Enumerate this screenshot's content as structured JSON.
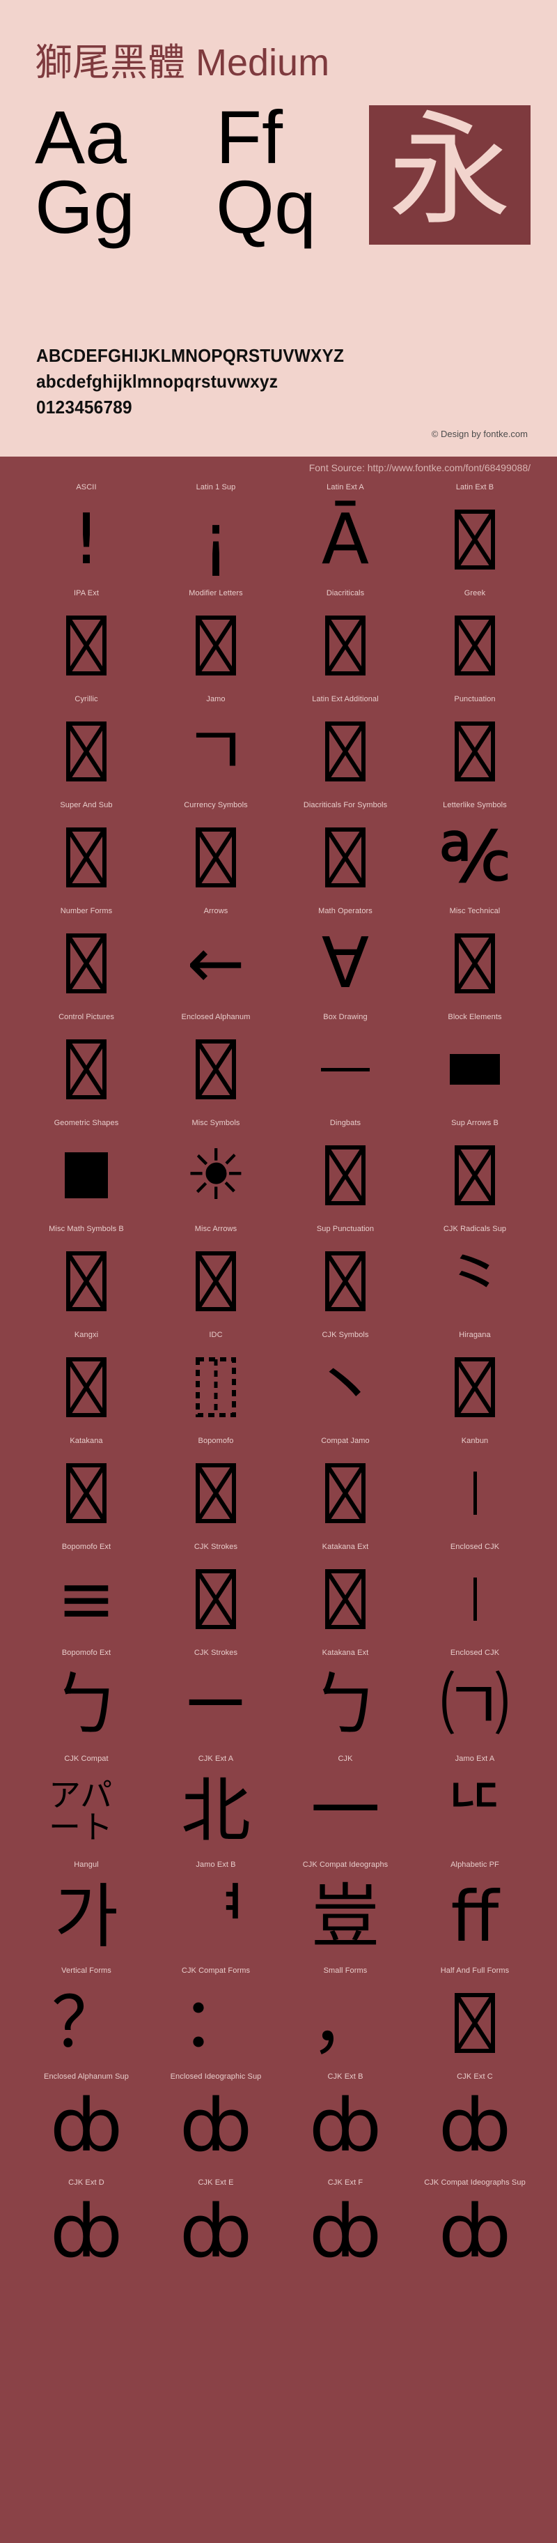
{
  "header": {
    "title_cjk": "獅尾黑體",
    "title_style": "Medium",
    "samples": {
      "aa": "Aa",
      "ff": "Ff",
      "gg": "Gg",
      "qq": "Qq",
      "yong": "永"
    },
    "alphabet_upper": "ABCDEFGHIJKLMNOPQRSTUVWXYZ",
    "alphabet_lower": "abcdefghijklmnopqrstuvwxyz",
    "digits": "0123456789",
    "copyright": "© Design by fontke.com"
  },
  "source": {
    "label": "Font Source: http://www.fontke.com/font/68499088/"
  },
  "colors": {
    "header_bg": "#f2d4cd",
    "body_bg": "#8a4247",
    "title_fg": "#7e3a3e",
    "label_fg": "#e8cdcb",
    "glyph_fg": "#000000",
    "source_fg": "#d8b4b2"
  },
  "grid": {
    "rows": [
      [
        {
          "label": "ASCII",
          "glyph": "!",
          "kind": "big"
        },
        {
          "label": "Latin 1 Sup",
          "glyph": "¡",
          "kind": "big"
        },
        {
          "label": "Latin Ext A",
          "glyph": "Ā",
          "kind": "big"
        },
        {
          "label": "Latin Ext B",
          "glyph": "notdef",
          "kind": "notdef"
        }
      ],
      [
        {
          "label": "IPA Ext",
          "glyph": "notdef",
          "kind": "notdef"
        },
        {
          "label": "Modifier Letters",
          "glyph": "notdef",
          "kind": "notdef"
        },
        {
          "label": "Diacriticals",
          "glyph": "notdef",
          "kind": "notdef"
        },
        {
          "label": "Greek",
          "glyph": "notdef",
          "kind": "notdef"
        }
      ],
      [
        {
          "label": "Cyrillic",
          "glyph": "notdef",
          "kind": "notdef"
        },
        {
          "label": "Jamo",
          "glyph": "ㄱ",
          "kind": "big"
        },
        {
          "label": "Latin Ext Additional",
          "glyph": "notdef",
          "kind": "notdef"
        },
        {
          "label": "Punctuation",
          "glyph": "notdef",
          "kind": "notdef"
        }
      ],
      [
        {
          "label": "Super And Sub",
          "glyph": "notdef",
          "kind": "notdef"
        },
        {
          "label": "Currency Symbols",
          "glyph": "notdef",
          "kind": "notdef"
        },
        {
          "label": "Diacriticals For Symbols",
          "glyph": "notdef",
          "kind": "notdef"
        },
        {
          "label": "Letterlike Symbols",
          "glyph": "℀",
          "kind": "big"
        }
      ],
      [
        {
          "label": "Number Forms",
          "glyph": "notdef",
          "kind": "notdef"
        },
        {
          "label": "Arrows",
          "glyph": "←",
          "kind": "big"
        },
        {
          "label": "Math Operators",
          "glyph": "∀",
          "kind": "big"
        },
        {
          "label": "Misc Technical",
          "glyph": "notdef",
          "kind": "notdef"
        }
      ],
      [
        {
          "label": "Control Pictures",
          "glyph": "notdef",
          "kind": "notdef"
        },
        {
          "label": "Enclosed Alphanum",
          "glyph": "notdef",
          "kind": "notdef"
        },
        {
          "label": "Box Drawing",
          "glyph": "─",
          "kind": "hline"
        },
        {
          "label": "Block Elements",
          "glyph": "█",
          "kind": "block"
        }
      ],
      [
        {
          "label": "Geometric Shapes",
          "glyph": "■",
          "kind": "square"
        },
        {
          "label": "Misc Symbols",
          "glyph": "☀",
          "kind": "big"
        },
        {
          "label": "Dingbats",
          "glyph": "notdef",
          "kind": "notdef"
        },
        {
          "label": "Sup Arrows B",
          "glyph": "notdef",
          "kind": "notdef"
        }
      ],
      [
        {
          "label": "Misc Math Symbols B",
          "glyph": "notdef",
          "kind": "notdef"
        },
        {
          "label": "Misc Arrows",
          "glyph": "notdef",
          "kind": "notdef"
        },
        {
          "label": "Sup Punctuation",
          "glyph": "notdef",
          "kind": "notdef"
        },
        {
          "label": "CJK Radicals Sup",
          "glyph": "⺀",
          "kind": "big"
        }
      ],
      [
        {
          "label": "Kangxi",
          "glyph": "notdef",
          "kind": "notdef"
        },
        {
          "label": "IDC",
          "glyph": "⿰",
          "kind": "idc"
        },
        {
          "label": "CJK Symbols",
          "glyph": "丶",
          "kind": "big"
        },
        {
          "label": "Hiragana",
          "glyph": "notdef",
          "kind": "notdef"
        }
      ],
      [
        {
          "label": "Katakana",
          "glyph": "notdef",
          "kind": "notdef"
        },
        {
          "label": "Bopomofo",
          "glyph": "notdef",
          "kind": "notdef"
        },
        {
          "label": "Compat Jamo",
          "glyph": "notdef",
          "kind": "notdef"
        },
        {
          "label": "Kanbun",
          "glyph": "丨",
          "kind": "vline"
        }
      ],
      [
        {
          "label": "Bopomofo Ext",
          "glyph": "≡",
          "kind": "big"
        },
        {
          "label": "CJK Strokes",
          "glyph": "notdef",
          "kind": "notdef"
        },
        {
          "label": "Katakana Ext",
          "glyph": "notdef",
          "kind": "notdef"
        },
        {
          "label": "Enclosed CJK",
          "glyph": "丨",
          "kind": "vline"
        }
      ],
      [
        {
          "label": "Bopomofo Ext",
          "glyph": "ㄅ",
          "kind": "big"
        },
        {
          "label": "CJK Strokes",
          "glyph": "ㄧ",
          "kind": "big"
        },
        {
          "label": "Katakana Ext",
          "glyph": "ㄅ",
          "kind": "big"
        },
        {
          "label": "Enclosed CJK",
          "glyph": "㈀",
          "kind": "big"
        }
      ],
      [
        {
          "label": "CJK Compat",
          "glyph": "アパート",
          "kind": "compat"
        },
        {
          "label": "CJK Ext A",
          "glyph": "北",
          "kind": "big"
        },
        {
          "label": "CJK",
          "glyph": "一",
          "kind": "big"
        },
        {
          "label": "Jamo Ext A",
          "glyph": "ᄕ",
          "kind": "big"
        }
      ],
      [
        {
          "label": "Hangul",
          "glyph": "가",
          "kind": "big"
        },
        {
          "label": "Jamo Ext B",
          "glyph": "ᅧ",
          "kind": "big"
        },
        {
          "label": "CJK Compat Ideographs",
          "glyph": "豈",
          "kind": "big"
        },
        {
          "label": "Alphabetic PF",
          "glyph": "ﬀ",
          "kind": "big"
        }
      ],
      [
        {
          "label": "Vertical Forms",
          "glyph": "？",
          "kind": "big"
        },
        {
          "label": "CJK Compat Forms",
          "glyph": "：",
          "kind": "big"
        },
        {
          "label": "Small Forms",
          "glyph": "，",
          "kind": "big"
        },
        {
          "label": "Half And Full Forms",
          "glyph": "notdef",
          "kind": "notdef"
        }
      ],
      [
        {
          "label": "Enclosed Alphanum Sup",
          "glyph": "ȸ",
          "kind": "overflow"
        },
        {
          "label": "Enclosed Ideographic Sup",
          "glyph": "ȸ",
          "kind": "overflow"
        },
        {
          "label": "CJK Ext B",
          "glyph": "ȸ",
          "kind": "overflow"
        },
        {
          "label": "CJK Ext C",
          "glyph": "ȸ",
          "kind": "overflow"
        }
      ],
      [
        {
          "label": "CJK Ext D",
          "glyph": "ȸ",
          "kind": "overflow"
        },
        {
          "label": "CJK Ext E",
          "glyph": "ȸ",
          "kind": "overflow"
        },
        {
          "label": "CJK Ext F",
          "glyph": "ȸ",
          "kind": "overflow"
        },
        {
          "label": "CJK Compat Ideographs Sup",
          "glyph": "ȸ",
          "kind": "overflow"
        }
      ]
    ]
  }
}
